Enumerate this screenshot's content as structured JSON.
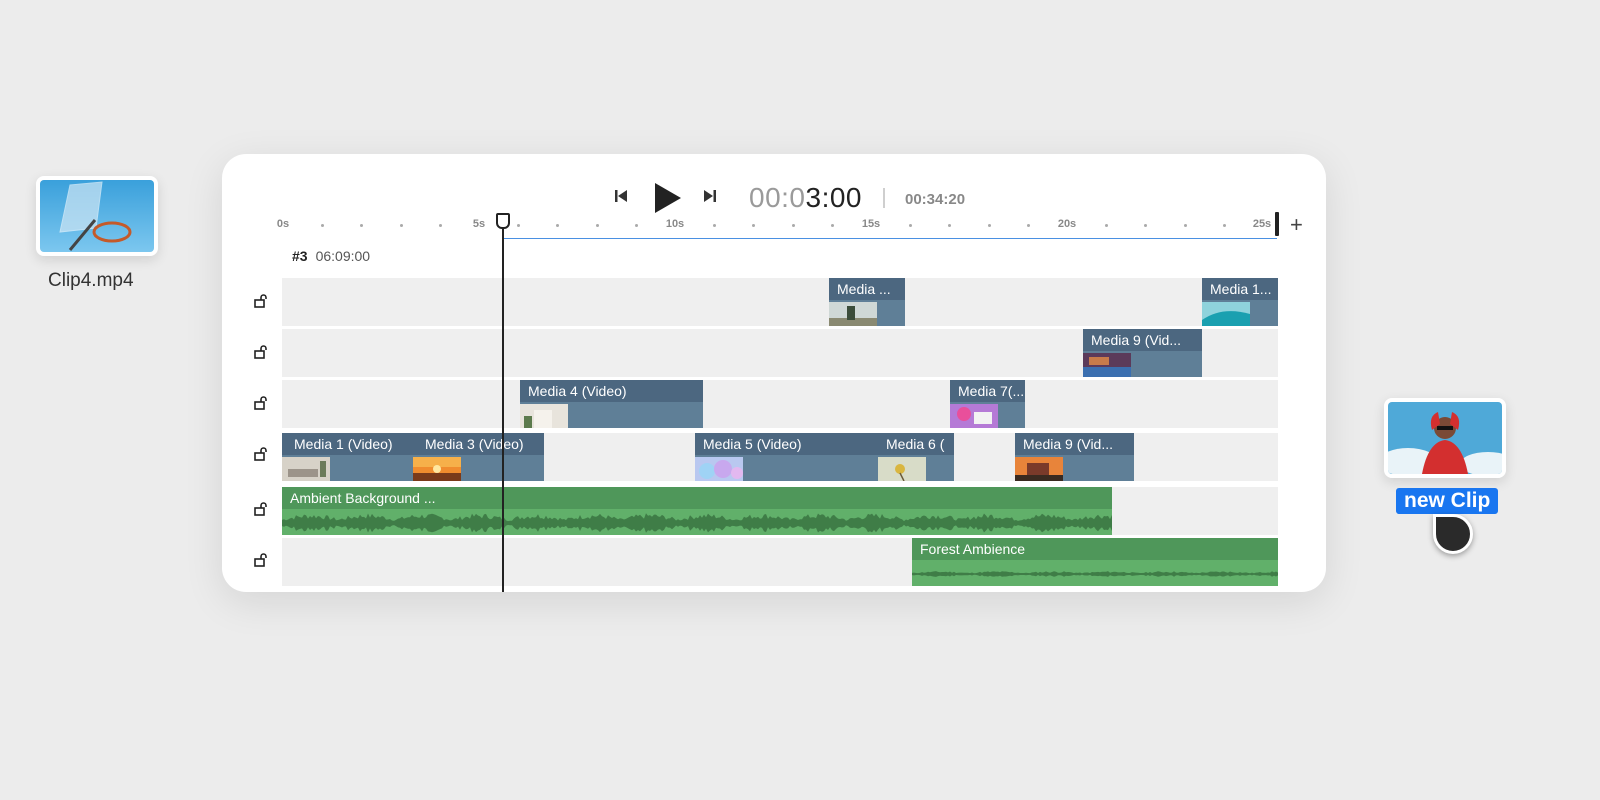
{
  "floating_clips": {
    "left_clip": {
      "filename": "Clip4.mp4"
    },
    "right_clip": {
      "tag_label": "new Clip"
    }
  },
  "transport": {
    "current_time_dim": "00:0",
    "current_time_bright": "3:00",
    "total_time": "00:34:20"
  },
  "ruler": {
    "labels": [
      "0s",
      "5s",
      "10s",
      "15s",
      "20s",
      "25s"
    ]
  },
  "track_info": {
    "index": "#3",
    "time": "06:09:00"
  },
  "tracks": [
    {
      "clips": [
        {
          "title": "Media ..."
        },
        {
          "title": "Media 1..."
        }
      ]
    },
    {
      "clips": [
        {
          "title": "Media 9 (Vid..."
        }
      ]
    },
    {
      "clips": [
        {
          "title": "Media 4 (Video)"
        },
        {
          "title": "Media 7(..."
        }
      ]
    },
    {
      "clips": [
        {
          "title": "Media 1 (Video)"
        },
        {
          "title": "Media 3 (Video)"
        },
        {
          "title": "Media 5 (Video)"
        },
        {
          "title": "Media 6 ("
        },
        {
          "title": "Media 9 (Vid..."
        }
      ]
    },
    {
      "clips": [
        {
          "title": "Ambient Background ..."
        }
      ]
    },
    {
      "clips": [
        {
          "title": "Forest Ambience"
        }
      ]
    }
  ],
  "colors": {
    "video_clip": "#5f7f97",
    "audio_clip": "#61b06a",
    "accent": "#1976f0"
  },
  "icons": [
    "skip-back-icon",
    "play-icon",
    "skip-forward-icon",
    "lock-open-icon",
    "plus-icon"
  ]
}
